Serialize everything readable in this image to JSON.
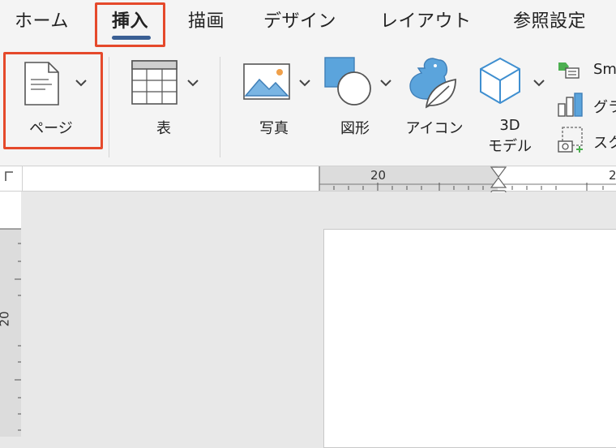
{
  "tabs": [
    {
      "label": "ホーム"
    },
    {
      "label": "挿入"
    },
    {
      "label": "描画"
    },
    {
      "label": "デザイン"
    },
    {
      "label": "レイアウト"
    },
    {
      "label": "参照設定"
    }
  ],
  "ribbon": {
    "page_label": "ページ",
    "table_label": "表",
    "photo_label": "写真",
    "shapes_label": "図形",
    "icons_label": "アイコン",
    "model3d_label_line1": "3D",
    "model3d_label_line2": "モデル",
    "smartart_label": "Sm",
    "chart_label": "グラ",
    "screenshot_label": "スク"
  },
  "ruler": {
    "top_number_1": "20",
    "top_number_2": "2",
    "left_number": "20"
  },
  "colors": {
    "highlight": "#e5492b",
    "accent": "#3a5f94",
    "icon_blue": "#5ba4dc"
  }
}
